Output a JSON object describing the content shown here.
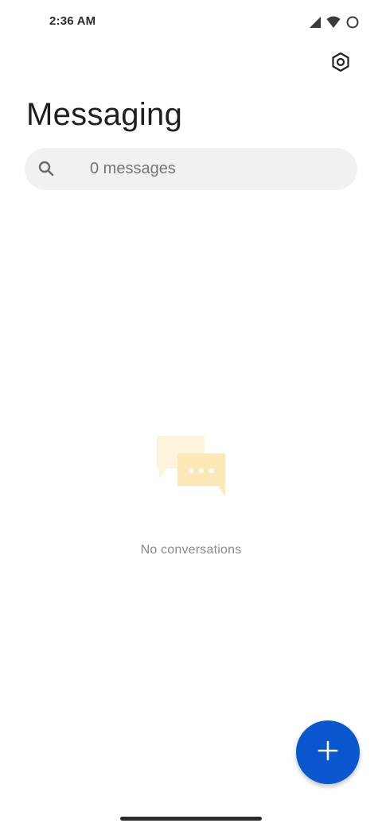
{
  "status_bar": {
    "time": "2:36 AM",
    "icons": [
      "cellular-signal-icon",
      "wifi-icon",
      "battery-icon"
    ]
  },
  "header": {
    "title": "Messaging",
    "settings_icon": "settings-icon"
  },
  "search": {
    "placeholder": "0 messages",
    "icon": "search-icon"
  },
  "empty_state": {
    "illustration": "chat-bubbles-icon",
    "message": "No conversations"
  },
  "fab": {
    "icon": "plus-icon",
    "color": "#0b57d0"
  },
  "colors": {
    "accent": "#0b57d0",
    "illustration_back": "#fdf3dc",
    "illustration_front": "#fde8b5"
  }
}
